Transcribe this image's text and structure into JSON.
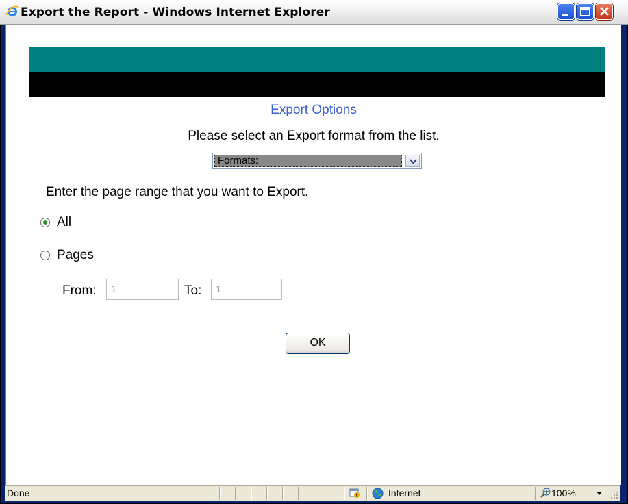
{
  "window": {
    "title": "Export the Report - Windows Internet Explorer"
  },
  "page": {
    "heading": "Export Options",
    "instruction": "Please select an Export format from the list.",
    "format_select": {
      "selected": "Formats:"
    },
    "range_instruction": "Enter the page range that you want to Export.",
    "radio_all_label": "All",
    "radio_pages_label": "Pages",
    "from_label": "From:",
    "from_value": "1",
    "to_label": "To:",
    "to_value": "1",
    "ok_label": "OK",
    "selected_range": "All"
  },
  "statusbar": {
    "status": "Done",
    "zone": "Internet",
    "zoom": "100%"
  },
  "colors": {
    "banner_teal": "#007f7f",
    "banner_black": "#000000",
    "heading_blue": "#3b5fd6"
  },
  "icons": [
    "ie-logo-icon",
    "minimize-icon",
    "maximize-icon",
    "close-icon",
    "chevron-down-icon",
    "security-shield-icon",
    "globe-icon",
    "zoom-icon",
    "resize-grip-icon"
  ]
}
